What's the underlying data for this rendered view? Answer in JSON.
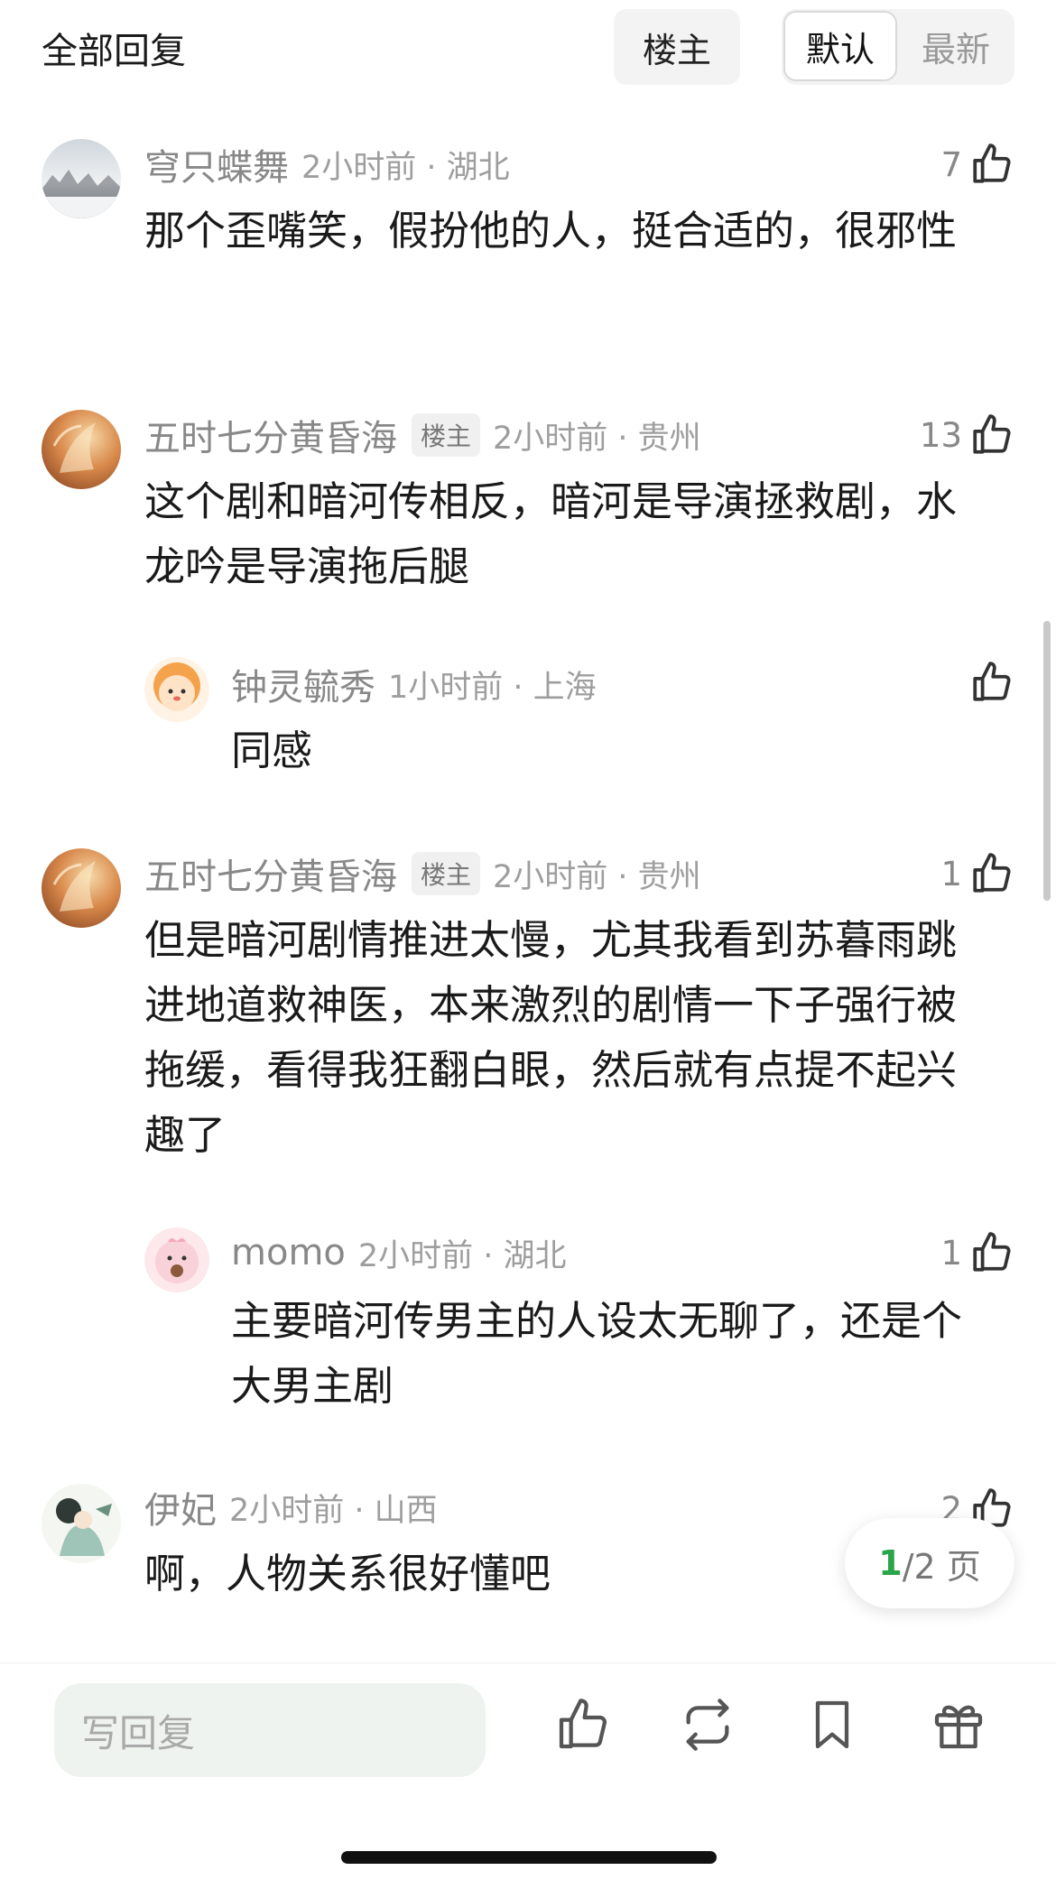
{
  "header": {
    "title": "全部回复",
    "owner_filter_label": "楼主",
    "sort_default_label": "默认",
    "sort_latest_label": "最新"
  },
  "comments": [
    {
      "author": "穹只蝶舞",
      "owner_tag": "",
      "time": "2小时前 · 湖北",
      "text": "那个歪嘴笑，假扮他的人，挺合适的，很邪性",
      "likes": "7"
    },
    {
      "author": "五时七分黄昏海",
      "owner_tag": "楼主",
      "time": "2小时前 · 贵州",
      "text": "这个剧和暗河传相反，暗河是导演拯救剧，水龙吟是导演拖后腿",
      "likes": "13"
    },
    {
      "author": "钟灵毓秀",
      "owner_tag": "",
      "time": "1小时前 · 上海",
      "text": "同感",
      "likes": ""
    },
    {
      "author": "五时七分黄昏海",
      "owner_tag": "楼主",
      "time": "2小时前 · 贵州",
      "text": "但是暗河剧情推进太慢，尤其我看到苏暮雨跳进地道救神医，本来激烈的剧情一下子强行被拖缓，看得我狂翻白眼，然后就有点提不起兴趣了",
      "likes": "1"
    },
    {
      "author": "momo",
      "owner_tag": "",
      "time": "2小时前 · 湖北",
      "text": "主要暗河传男主的人设太无聊了，还是个大男主剧",
      "likes": "1"
    },
    {
      "author": "伊妃",
      "owner_tag": "",
      "time": "2小时前 · 山西",
      "text": "啊，人物关系很好懂吧",
      "likes": "2"
    }
  ],
  "pager": {
    "current": "1",
    "total_suffix": "/2 页"
  },
  "bottom_bar": {
    "reply_placeholder": "写回复"
  },
  "colors": {
    "accent_green": "#2aa549",
    "meta_gray": "#9e9e9e",
    "input_bg": "#eef3ef"
  }
}
